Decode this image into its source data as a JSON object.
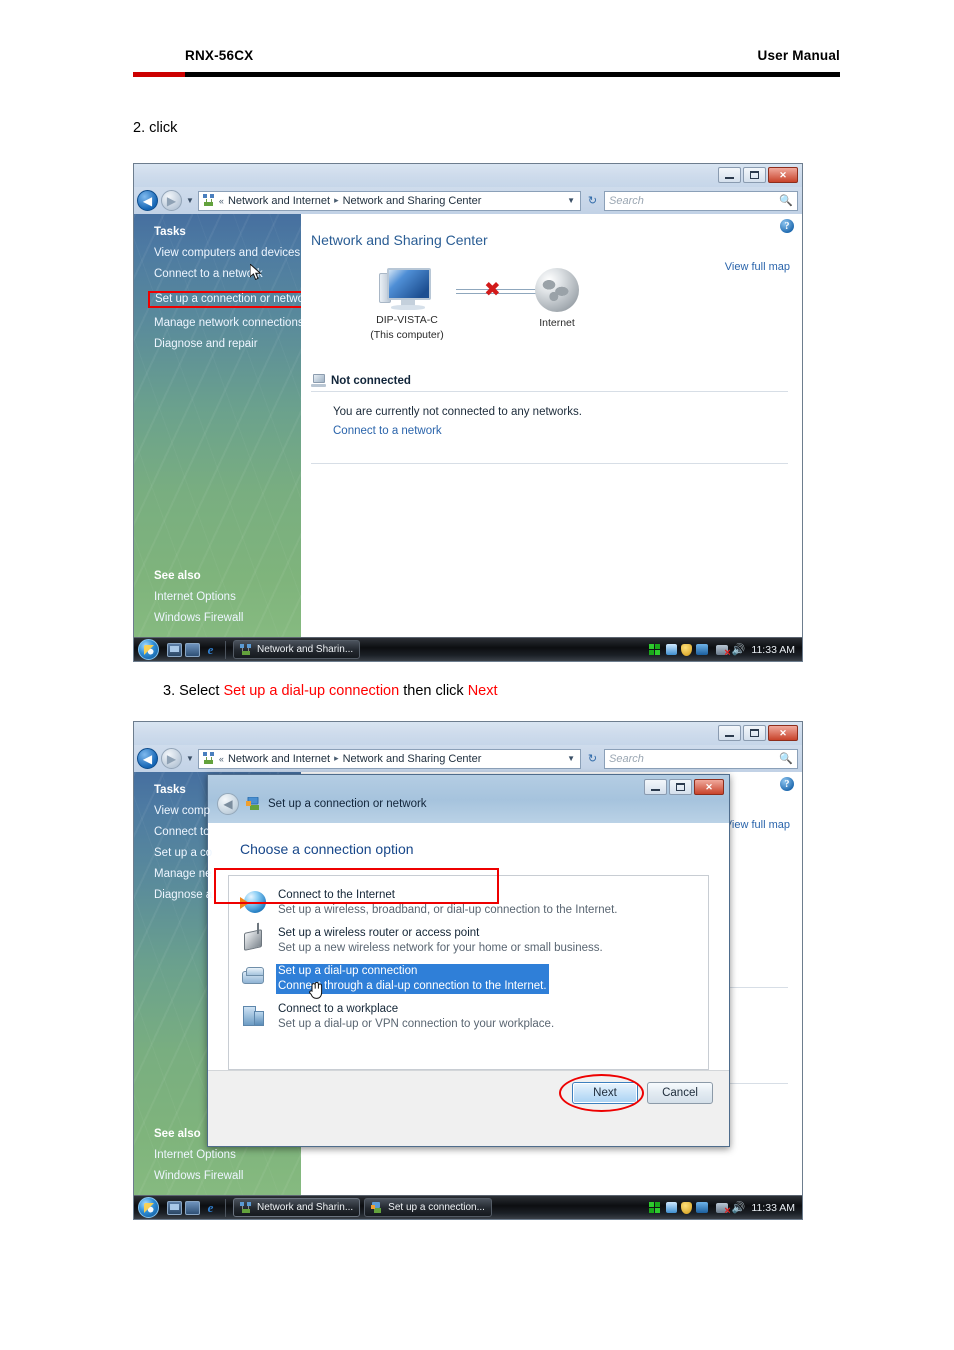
{
  "page_header": {
    "left_text": "RNX-56CX",
    "right_text": "User  Manual"
  },
  "steps": {
    "step2": {
      "full": "2. click"
    },
    "step3": {
      "prefix": "3. Select ",
      "highlight1": "Set up a dial-up connection",
      "middle": " then click ",
      "highlight2": "Next",
      "highlight_color": "#ff0000"
    }
  },
  "explorer": {
    "titlebar": {
      "minimize_label": "Minimize",
      "maximize_label": "Maximize",
      "close_label": "Close"
    },
    "address_bar": {
      "back_label": "Back",
      "forward_label": "Forward",
      "recent_pages_label": "Recent Pages",
      "chevrons": "«",
      "crumb1": "Network and Internet",
      "crumb_sep": "▸",
      "crumb2": "Network and Sharing Center",
      "refresh_label": "Refresh"
    },
    "search": {
      "placeholder": "Search"
    },
    "sidebar": {
      "tasks_heading": "Tasks",
      "items": [
        {
          "label": "View computers and devices",
          "highlighted": false
        },
        {
          "label": "Connect to a network",
          "highlighted": false
        },
        {
          "label": "Set up a connection or network",
          "highlighted": true
        },
        {
          "label": "Manage network connections",
          "highlighted": false
        },
        {
          "label": "Diagnose and repair",
          "highlighted": false
        }
      ],
      "see_also_heading": "See also",
      "see_also_items": [
        {
          "label": "Internet Options"
        },
        {
          "label": "Windows Firewall"
        }
      ],
      "clipped_items": [
        {
          "label": "View comp"
        },
        {
          "label": "Connect to"
        },
        {
          "label": "Set up a co"
        },
        {
          "label": "Manage ne"
        },
        {
          "label": "Diagnose a"
        }
      ]
    },
    "content": {
      "title": "Network and Sharing Center",
      "help_label": "?",
      "view_full_map": "View full map",
      "map": {
        "computer_name": "DIP-VISTA-C",
        "computer_sub": "(This computer)",
        "internet_label": "Internet",
        "link_broken": true
      },
      "status": {
        "heading": "Not connected",
        "message": "You are currently not connected to any networks.",
        "link": "Connect to a network"
      }
    },
    "taskbar": {
      "start_label": "Start",
      "quicklaunch": [
        "show-desktop-icon",
        "switch-windows-icon",
        "internet-explorer-icon"
      ],
      "buttons_screen1": [
        {
          "label": "Network and Sharin...",
          "active": true
        }
      ],
      "buttons_screen2": [
        {
          "label": "Network and Sharin...",
          "active": false
        },
        {
          "label": "Set up a connection...",
          "active": true
        }
      ],
      "tray_icons": [
        "network-grid-icon",
        "security-shield-icon",
        "blue-app-icon",
        "network-disconnected-icon",
        "volume-icon"
      ],
      "clock": "11:33 AM"
    }
  },
  "wizard": {
    "title": "Set up a connection or network",
    "back_label": "Back",
    "minimize_label": "Minimize",
    "maximize_label": "Maximize",
    "close_label": "Close",
    "heading": "Choose a connection option",
    "options": [
      {
        "icon": "globe-arrow-icon",
        "title": "Connect to the Internet",
        "desc": "Set up a wireless, broadband, or dial-up connection to the Internet.",
        "selected": false
      },
      {
        "icon": "wireless-router-icon",
        "title": "Set up a wireless router or access point",
        "desc": "Set up a new wireless network for your home or small business.",
        "selected": false
      },
      {
        "icon": "dialup-modem-icon",
        "title": "Set up a dial-up connection",
        "desc": "Connect through a dial-up connection to the Internet.",
        "selected": true
      },
      {
        "icon": "workplace-building-icon",
        "title": "Connect to a workplace",
        "desc": "Set up a dial-up or VPN connection to your workplace.",
        "selected": false
      }
    ],
    "next_label": "Next",
    "cancel_label": "Cancel",
    "next_circled": true
  }
}
